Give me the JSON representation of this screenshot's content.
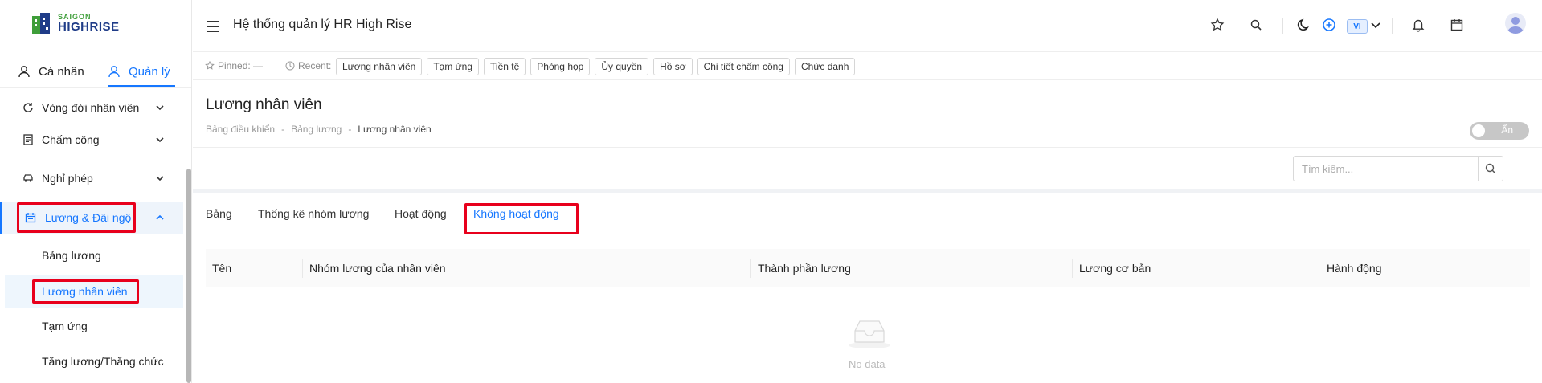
{
  "brand": {
    "line1": "SAIGON",
    "line2": "HIGHRISE",
    "green": "#3f9e3a",
    "blue": "#1f3c88"
  },
  "mode_tabs": {
    "personal": "Cá nhân",
    "manage": "Quản lý"
  },
  "sidebar": {
    "items": [
      {
        "label": "Vòng đời nhân viên",
        "icon": "refresh-icon"
      },
      {
        "label": "Chấm công",
        "icon": "document-icon"
      },
      {
        "label": "Nghỉ phép",
        "icon": "car-icon"
      },
      {
        "label": "Lương & Đãi ngộ",
        "icon": "calendar-icon",
        "expanded": true
      }
    ],
    "subitems": [
      {
        "label": "Bảng lương"
      },
      {
        "label": "Lương nhân viên",
        "active": true
      },
      {
        "label": "Tạm ứng"
      },
      {
        "label": "Tăng lương/Thăng chức"
      }
    ]
  },
  "header": {
    "title": "Hệ thống quản lý HR High Rise",
    "lang": "VI",
    "icons": [
      "star-icon",
      "search-icon",
      "moon-icon",
      "plus-circle-icon",
      "chevron-down-icon",
      "bell-icon",
      "calendar-icon",
      "avatar"
    ]
  },
  "recent": {
    "pinned_label": "Pinned:",
    "pinned_value": "—",
    "recent_label": "Recent:",
    "chips": [
      "Lương nhân viên",
      "Tạm ứng",
      "Tiền tệ",
      "Phòng họp",
      "Ủy quyền",
      "Hồ sơ",
      "Chi tiết chấm công",
      "Chức danh"
    ]
  },
  "page": {
    "title": "Lương nhân viên",
    "breadcrumb": [
      "Bảng điều khiển",
      "Bảng lương",
      "Lương nhân viên"
    ],
    "toggle_label": "Ẩn",
    "search_placeholder": "Tìm kiếm..."
  },
  "tabs": [
    {
      "label": "Bảng"
    },
    {
      "label": "Thống kê nhóm lương"
    },
    {
      "label": "Hoạt động"
    },
    {
      "label": "Không hoạt động",
      "active": true
    }
  ],
  "table": {
    "columns": [
      "Tên",
      "Nhóm lương của nhân viên",
      "Thành phần lương",
      "Lương cơ bản",
      "Hành động"
    ],
    "rows": [],
    "empty_text": "No data"
  },
  "colors": {
    "accent": "#1677ff",
    "highlight": "#e8001c"
  }
}
